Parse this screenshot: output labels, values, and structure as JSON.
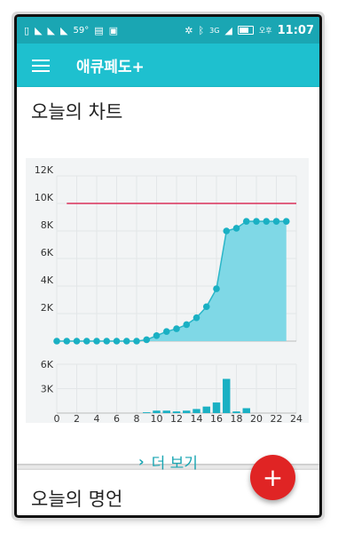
{
  "status_bar": {
    "left_icons": [
      "sim-icon",
      "wifi-signal-icon",
      "wifi-signal-icon",
      "wifi-signal-icon",
      "weather-icon",
      "clipboard-icon",
      "bag-check-icon"
    ],
    "temperature": "59°",
    "network": "3G",
    "ampm": "오후",
    "time": "11:07"
  },
  "app_bar": {
    "title": "애큐페도+"
  },
  "chart_card": {
    "title": "오늘의 차트",
    "more_label": "더 보기"
  },
  "quote_card": {
    "title": "오늘의 명언"
  },
  "colors": {
    "accent": "#1ec0cf",
    "statusbar": "#1aa6b3",
    "fill": "#7fd8e6",
    "goal_line": "#d9305a",
    "fab": "#e02424"
  },
  "chart_data": [
    {
      "type": "area",
      "x": [
        0,
        1,
        2,
        3,
        4,
        5,
        6,
        7,
        8,
        9,
        10,
        11,
        12,
        13,
        14,
        15,
        16,
        17,
        18,
        19,
        20,
        21,
        22,
        23
      ],
      "values": [
        0,
        0,
        0,
        0,
        0,
        0,
        0,
        0,
        0,
        100,
        400,
        700,
        900,
        1200,
        1700,
        2500,
        3800,
        8000,
        8200,
        8700,
        8700,
        8700,
        8700,
        8700
      ],
      "goal": 10000,
      "ylim": [
        0,
        12000
      ],
      "yticks": [
        "12K",
        "10K",
        "8K",
        "6K",
        "4K",
        "2K"
      ],
      "ytick_values": [
        12000,
        10000,
        8000,
        6000,
        4000,
        2000
      ],
      "grid": true
    },
    {
      "type": "bar",
      "x": [
        0,
        1,
        2,
        3,
        4,
        5,
        6,
        7,
        8,
        9,
        10,
        11,
        12,
        13,
        14,
        15,
        16,
        17,
        18,
        19,
        20,
        21,
        22,
        23
      ],
      "values": [
        0,
        0,
        0,
        0,
        0,
        0,
        0,
        0,
        0,
        100,
        300,
        300,
        200,
        300,
        500,
        800,
        1300,
        4200,
        200,
        600,
        0,
        0,
        0,
        0
      ],
      "ylim": [
        0,
        6000
      ],
      "yticks": [
        "6K",
        "3K"
      ],
      "ytick_values": [
        6000,
        3000
      ],
      "xticks": [
        "0",
        "2",
        "4",
        "6",
        "8",
        "10",
        "12",
        "14",
        "16",
        "18",
        "20",
        "22",
        "24"
      ],
      "xtick_values": [
        0,
        2,
        4,
        6,
        8,
        10,
        12,
        14,
        16,
        18,
        20,
        22,
        24
      ],
      "grid": true
    }
  ]
}
